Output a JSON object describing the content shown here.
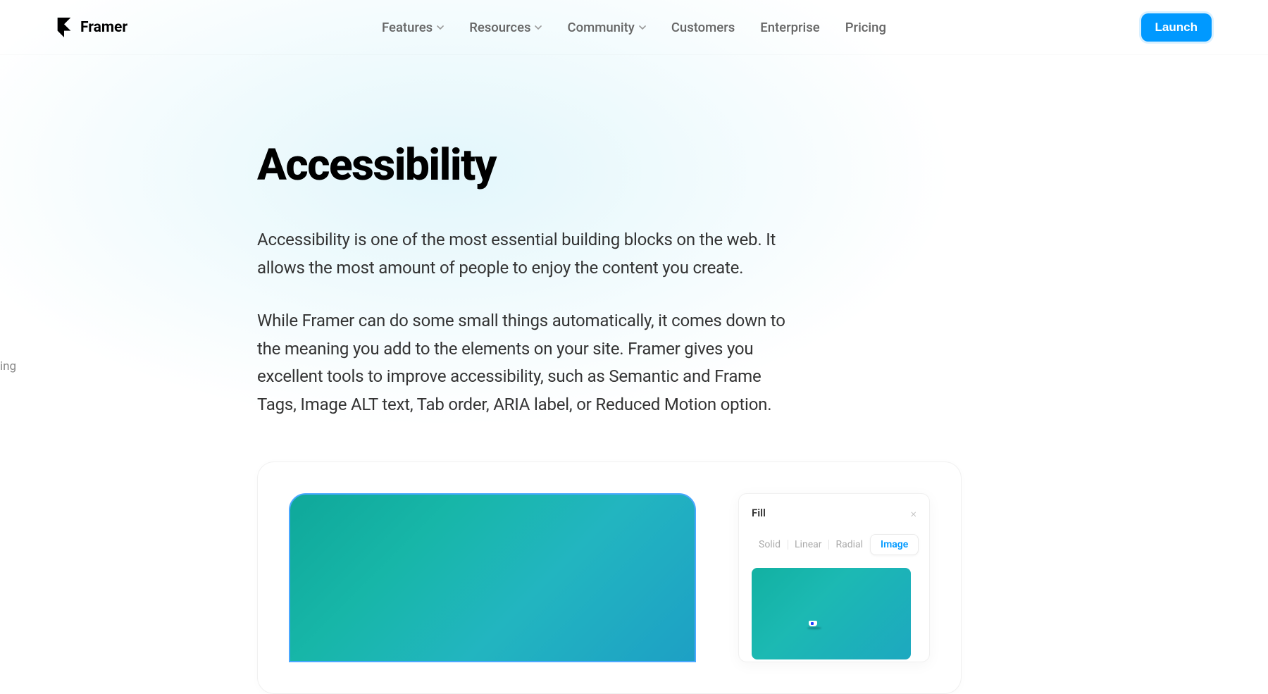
{
  "brand": {
    "name": "Framer"
  },
  "nav": {
    "items": [
      {
        "label": "Features",
        "hasDropdown": true
      },
      {
        "label": "Resources",
        "hasDropdown": true
      },
      {
        "label": "Community",
        "hasDropdown": true
      },
      {
        "label": "Customers",
        "hasDropdown": false
      },
      {
        "label": "Enterprise",
        "hasDropdown": false
      },
      {
        "label": "Pricing",
        "hasDropdown": false
      }
    ],
    "cta": "Launch"
  },
  "edgeWord": "ing",
  "page": {
    "title": "Accessibility",
    "para1": "Accessibility is one of the most essential building blocks on the web. It allows the most amount of people to enjoy the content you create.",
    "para2": "While Framer can do some small things automatically, it comes down to the meaning you add to the elements on your site. Framer gives you excellent tools to improve accessibility, such as Semantic and Frame Tags, Image ALT text, Tab order, ARIA label, or Reduced Motion option."
  },
  "fillPanel": {
    "title": "Fill",
    "tabs": {
      "solid": "Solid",
      "linear": "Linear",
      "radial": "Radial",
      "image": "Image"
    },
    "activeTab": "Image"
  }
}
